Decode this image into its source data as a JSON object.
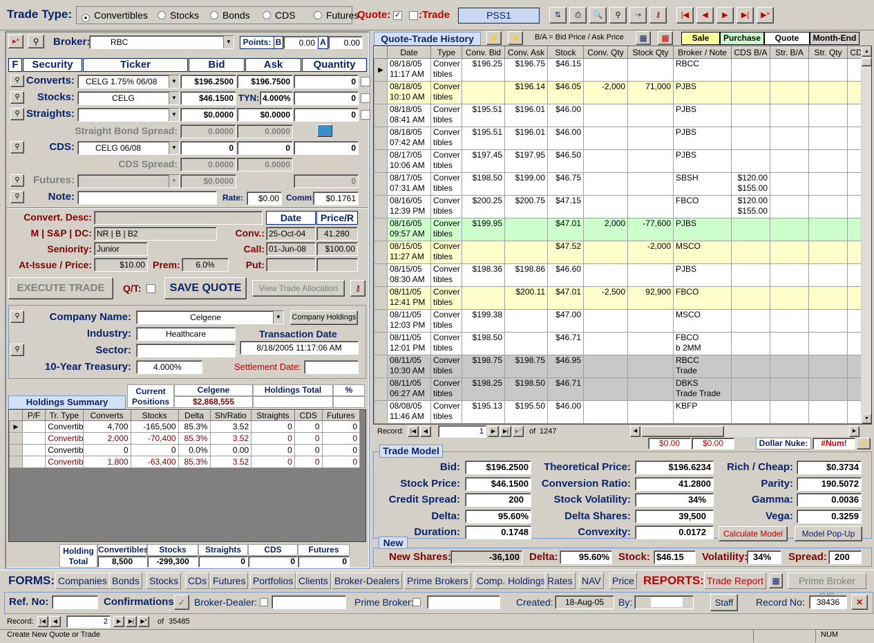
{
  "header": {
    "trade_type_label": "Trade Type:",
    "types": [
      {
        "label": "Convertibles",
        "selected": true
      },
      {
        "label": "Stocks",
        "selected": false
      },
      {
        "label": "Bonds",
        "selected": false
      },
      {
        "label": "CDS",
        "selected": false
      },
      {
        "label": "Futures",
        "selected": false
      }
    ],
    "quote_label": "Quote:",
    "trade_label": ":Trade",
    "pss_label": "PSS1"
  },
  "broker": {
    "label": "Broker:",
    "value": "RBC",
    "points_label": "Points:",
    "b_label": "B",
    "b_value": "0.00",
    "a_label": "A",
    "a_value": "0.00"
  },
  "security_table": {
    "headers": [
      "F",
      "Security",
      "Ticker",
      "Bid",
      "Ask",
      "Quantity"
    ],
    "converts": {
      "label": "Converts:",
      "ticker": "CELG 1.75% 06/08",
      "bid": "$196.2500",
      "ask": "$196.7500",
      "qty": "0"
    },
    "stocks": {
      "label": "Stocks:",
      "ticker": "CELG",
      "bid": "$46.1500",
      "tyn_label": "TYN:",
      "tyn": "4.000%",
      "qty": "0"
    },
    "straights": {
      "label": "Straights:",
      "ticker": "",
      "bid": "$0.0000",
      "ask": "$0.0000",
      "qty": "0"
    },
    "straight_spread_label": "Straight Bond Spread:",
    "straight_spread_bid": "0.0000",
    "straight_spread_ask": "0.0000",
    "cds": {
      "label": "CDS:",
      "ticker": "CELG 06/08",
      "bid": "0",
      "ask": "0",
      "qty": "0"
    },
    "cds_spread_label": "CDS Spread:",
    "cds_spread_bid": "0.0000",
    "cds_spread_ask": "0.0000",
    "futures": {
      "label": "Futures:",
      "bid": "$0.0000",
      "qty": "0"
    },
    "note_label": "Note:",
    "rate_label": "Rate:",
    "rate": "$0.00",
    "comm_label": "Comm:",
    "comm": "$0.1761"
  },
  "convert": {
    "desc_label": "Convert. Desc:",
    "date_header": "Date",
    "price_header": "Price/R",
    "rating_label": "M | S&P | DC:",
    "rating": "NR | B | B2",
    "conv_label": "Conv.:",
    "conv_date": "25-Oct-04",
    "conv_price": "41.280",
    "seniority_label": "Seniority:",
    "seniority": "Junior",
    "call_label": "Call:",
    "call_date": "01-Jun-08",
    "call_price": "$100.00",
    "issue_label": "At-Issue / Price:",
    "issue_price": "$10.00",
    "prem_label": "Prem:",
    "prem": "6.0%",
    "put_label": "Put:"
  },
  "actions": {
    "execute": "EXECUTE TRADE",
    "qt_label": "Q/T:",
    "save_quote": "SAVE QUOTE",
    "view_alloc": "View Trade Allocation"
  },
  "company": {
    "name_label": "Company Name:",
    "name": "Celgene",
    "holdings_btn": "Company Holdings",
    "industry_label": "Industry:",
    "industry": "Healthcare",
    "sector_label": "Sector:",
    "sector": "",
    "trans_date_label": "Transaction Date",
    "trans_date": "8/18/2005 11:17:06 AM",
    "treasury_label": "10-Year Treasury:",
    "treasury": "4.000%",
    "settlement_label": "Settlement Date:"
  },
  "holdings": {
    "current_positions": "Current Positions",
    "company": "Celgene",
    "holdings_total": "Holdings Total",
    "pct": "%",
    "summary_label": "Holdings Summary",
    "amount": "$2,868,555",
    "headers": [
      "P/F",
      "Tr. Type",
      "Converts",
      "Stocks",
      "Delta",
      "Sh/Ratio",
      "Straights",
      "CDS",
      "Futures"
    ],
    "rows": [
      {
        "pf": "",
        "type": "Convertib",
        "converts": "4,700",
        "stocks": "-165,500",
        "delta": "85.3%",
        "ratio": "3.52",
        "straights": "0",
        "cds": "0",
        "futures": "0",
        "color": "#000000"
      },
      {
        "pf": "",
        "type": "Convertib",
        "converts": "2,000",
        "stocks": "-70,400",
        "delta": "85.3%",
        "ratio": "3.52",
        "straights": "0",
        "cds": "0",
        "futures": "0",
        "color": "#800000"
      },
      {
        "pf": "",
        "type": "Convertib",
        "converts": "0",
        "stocks": "0",
        "delta": "0.0%",
        "ratio": "0.00",
        "straights": "0",
        "cds": "0",
        "futures": "0",
        "color": "#000000"
      },
      {
        "pf": "",
        "type": "Convertib",
        "converts": "1,800",
        "stocks": "-63,400",
        "delta": "85.3%",
        "ratio": "3.52",
        "straights": "0",
        "cds": "0",
        "futures": "0",
        "color": "#800000"
      }
    ],
    "total_label": "Holding Total",
    "totals_headers": [
      "Convertibles",
      "Stocks",
      "Straights",
      "CDS",
      "Futures"
    ],
    "totals": [
      "8,500",
      "-299,300",
      "0",
      "0",
      "0"
    ]
  },
  "history": {
    "tab_label": "Quote-Trade History",
    "ba_note": "B/A = Bid Price / Ask Price",
    "legend": [
      "Sale",
      "Purchase",
      "Quote",
      "Month-End"
    ],
    "headers": [
      "Date",
      "Type",
      "Conv. Bid",
      "Conv. Ask",
      "Stock",
      "Conv. Qty",
      "Stock Qty",
      "Broker / Note",
      "CDS B/A",
      "Str. B/A",
      "Str. Qty",
      "CDS"
    ],
    "rows": [
      {
        "date": "08/18/05",
        "time": "11:17 AM",
        "bid": "$196.25",
        "ask": "$196.75",
        "stock": "$46.15",
        "cq": "",
        "sq": "",
        "broker": "RBCC",
        "note": "",
        "cds1": "",
        "cds2": "",
        "cls": ""
      },
      {
        "date": "08/18/05",
        "time": "10:10 AM",
        "bid": "",
        "ask": "$196.14",
        "stock": "$46.05",
        "cq": "-2,000",
        "sq": "71,000",
        "broker": "PJBS",
        "note": "",
        "cds1": "",
        "cds2": "",
        "cls": "row-yellow"
      },
      {
        "date": "08/18/05",
        "time": "08:41 AM",
        "bid": "$195.51",
        "ask": "$196.01",
        "stock": "$46.00",
        "cq": "",
        "sq": "",
        "broker": "PJBS",
        "note": "",
        "cds1": "",
        "cds2": "",
        "cls": ""
      },
      {
        "date": "08/18/05",
        "time": "07:42 AM",
        "bid": "$195.51",
        "ask": "$196.01",
        "stock": "$46.00",
        "cq": "",
        "sq": "",
        "broker": "PJBS",
        "note": "",
        "cds1": "",
        "cds2": "",
        "cls": ""
      },
      {
        "date": "08/17/05",
        "time": "10:06 AM",
        "bid": "$197.45",
        "ask": "$197.95",
        "stock": "$46.50",
        "cq": "",
        "sq": "",
        "broker": "PJBS",
        "note": "",
        "cds1": "",
        "cds2": "",
        "cls": ""
      },
      {
        "date": "08/17/05",
        "time": "07:31 AM",
        "bid": "$198.50",
        "ask": "$199.00",
        "stock": "$46.75",
        "cq": "",
        "sq": "",
        "broker": "SBSH",
        "note": "",
        "cds1": "$120.00",
        "cds2": "$155.00",
        "cls": ""
      },
      {
        "date": "08/16/05",
        "time": "12:39 PM",
        "bid": "$200.25",
        "ask": "$200.75",
        "stock": "$47.15",
        "cq": "",
        "sq": "",
        "broker": "FBCO",
        "note": "",
        "cds1": "$120.00",
        "cds2": "$155.00",
        "cls": ""
      },
      {
        "date": "08/16/05",
        "time": "09:57 AM",
        "bid": "$199.95",
        "ask": "",
        "stock": "$47.01",
        "cq": "2,000",
        "sq": "-77,600",
        "broker": "PJBS",
        "note": "",
        "cds1": "",
        "cds2": "",
        "cls": "row-green"
      },
      {
        "date": "08/15/05",
        "time": "11:27 AM",
        "bid": "",
        "ask": "",
        "stock": "$47.52",
        "cq": "",
        "sq": "-2,000",
        "broker": "MSCO",
        "note": "",
        "cds1": "",
        "cds2": "",
        "cls": "row-yellow"
      },
      {
        "date": "08/15/05",
        "time": "08:30 AM",
        "bid": "$198.36",
        "ask": "$198.86",
        "stock": "$46.60",
        "cq": "",
        "sq": "",
        "broker": "PJBS",
        "note": "",
        "cds1": "",
        "cds2": "",
        "cls": ""
      },
      {
        "date": "08/11/05",
        "time": "12:41 PM",
        "bid": "",
        "ask": "$200.11",
        "stock": "$47.01",
        "cq": "-2,500",
        "sq": "92,900",
        "broker": "FBCO",
        "note": "",
        "cds1": "",
        "cds2": "",
        "cls": "row-yellow"
      },
      {
        "date": "08/11/05",
        "time": "12:03 PM",
        "bid": "$199.38",
        "ask": "",
        "stock": "$47.00",
        "cq": "",
        "sq": "",
        "broker": "MSCO",
        "note": "",
        "cds1": "",
        "cds2": "",
        "cls": ""
      },
      {
        "date": "08/11/05",
        "time": "12:01 PM",
        "bid": "$198.50",
        "ask": "",
        "stock": "$46.71",
        "cq": "",
        "sq": "",
        "broker": "FBCO",
        "note": "b 2MM",
        "cds1": "",
        "cds2": "",
        "cls": ""
      },
      {
        "date": "08/11/05",
        "time": "10:30 AM",
        "bid": "$198.75",
        "ask": "$198.75",
        "stock": "$46.95",
        "cq": "",
        "sq": "",
        "broker": "RBCC",
        "note": "Trade",
        "cds1": "",
        "cds2": "",
        "cls": "row-gray"
      },
      {
        "date": "08/11/05",
        "time": "06:27 AM",
        "bid": "$198.25",
        "ask": "$198.50",
        "stock": "$46.71",
        "cq": "",
        "sq": "",
        "broker": "DBKS",
        "note": "Trade Trade",
        "cds1": "",
        "cds2": "",
        "cls": "row-gray"
      },
      {
        "date": "08/08/05",
        "time": "11:46 AM",
        "bid": "$195.13",
        "ask": "$195.50",
        "stock": "$46.00",
        "cq": "",
        "sq": "",
        "broker": "KBFP",
        "note": "",
        "cds1": "",
        "cds2": "",
        "cls": ""
      }
    ],
    "type_line1": "Conver",
    "type_line2": "tibles",
    "record_label": "Record:",
    "record_value": "1",
    "record_of": "of",
    "record_total": "1247"
  },
  "nuke": {
    "v1": "$0.00",
    "v2": "$0.00",
    "label": "Dollar Nuke:",
    "value": "#Num!"
  },
  "model": {
    "title": "Trade Model",
    "bid_label": "Bid:",
    "bid": "$196.2500",
    "stock_label": "Stock Price:",
    "stock": "$46.1500",
    "credit_label": "Credit Spread:",
    "credit": "200",
    "delta_label": "Delta:",
    "delta": "95.60%",
    "duration_label": "Duration:",
    "duration": "0.1748",
    "theo_label": "Theoretical Price:",
    "theo": "$196.6234",
    "ratio_label": "Conversion Ratio:",
    "ratio": "41.2800",
    "vol_label": "Stock Volatility:",
    "vol": "34%",
    "dshares_label": "Delta Shares:",
    "dshares": "39,500",
    "convex_label": "Convexity:",
    "convex": "0.0172",
    "rich_label": "Rich / Cheap:",
    "rich": "$0.3734",
    "parity_label": "Parity:",
    "parity": "190.5072",
    "gamma_label": "Gamma:",
    "gamma": "0.0036",
    "vega_label": "Vega:",
    "vega": "0.3259",
    "calc_btn": "Calculate Model",
    "popup_btn": "Model Pop-Up"
  },
  "newrow": {
    "tab": "New",
    "shares_label": "New Shares:",
    "shares": "-36,100",
    "delta_label": "Delta:",
    "delta": "95.60%",
    "stock_label": "Stock:",
    "stock": "$46.15",
    "vol_label": "Volatility:",
    "vol": "34%",
    "spread_label": "Spread:",
    "spread": "200"
  },
  "forms": {
    "label": "FORMS:",
    "links": [
      "Companies",
      "Bonds",
      "Stocks",
      "CDs",
      "Futures",
      "Portfolios",
      "Clients",
      "Broker-Dealers",
      "Prime Brokers",
      "Comp. Holdings",
      "Rates",
      "NAV",
      "Price"
    ],
    "reports_label": "REPORTS:",
    "trade_report": "Trade Report",
    "prime_broker": "Prime Broker S/S"
  },
  "footer": {
    "ref_label": "Ref. No:",
    "confirm_label": "Confirmations:",
    "bd_label": "Broker-Dealer:",
    "pb_label": "Prime Broker:",
    "created_label": "Created:",
    "created": "18-Aug-05",
    "by_label": "By:",
    "staff_btn": "Staff",
    "record_no_label": "Record No:",
    "record_no": "38436",
    "record_label": "Record:",
    "record_value": "2",
    "record_of": "of",
    "record_total": "35485"
  },
  "status": {
    "text": "Create New Quote or Trade",
    "num": "NUM"
  }
}
